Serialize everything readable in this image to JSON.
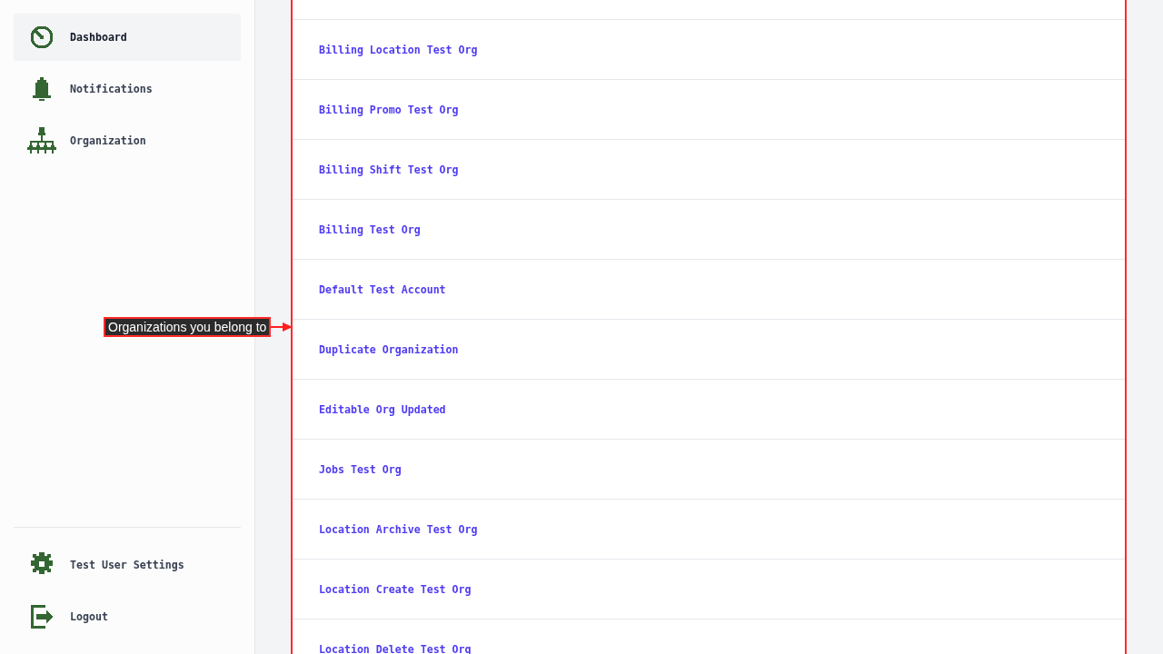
{
  "sidebar": {
    "nav_items": [
      {
        "label": "Dashboard",
        "kind": "dashboard",
        "selected": true
      },
      {
        "label": "Notifications",
        "kind": "notifications",
        "selected": false
      },
      {
        "label": "Organization",
        "kind": "organization",
        "selected": false
      }
    ],
    "footer_items": [
      {
        "label": "Test User Settings",
        "kind": "settings",
        "selected": false
      },
      {
        "label": "Logout",
        "kind": "logout",
        "selected": false
      }
    ]
  },
  "organizations": {
    "rows": [
      {
        "name": "Billing Location Test Org"
      },
      {
        "name": "Billing Promo Test Org"
      },
      {
        "name": "Billing Shift Test Org"
      },
      {
        "name": "Billing Test Org"
      },
      {
        "name": "Default Test Account"
      },
      {
        "name": "Duplicate Organization"
      },
      {
        "name": "Editable Org Updated"
      },
      {
        "name": "Jobs Test Org"
      },
      {
        "name": "Location Archive Test Org"
      },
      {
        "name": "Location Create Test Org"
      },
      {
        "name": "Location Delete Test Org"
      }
    ]
  },
  "annotation": {
    "label": "Organizations you belong to"
  }
}
